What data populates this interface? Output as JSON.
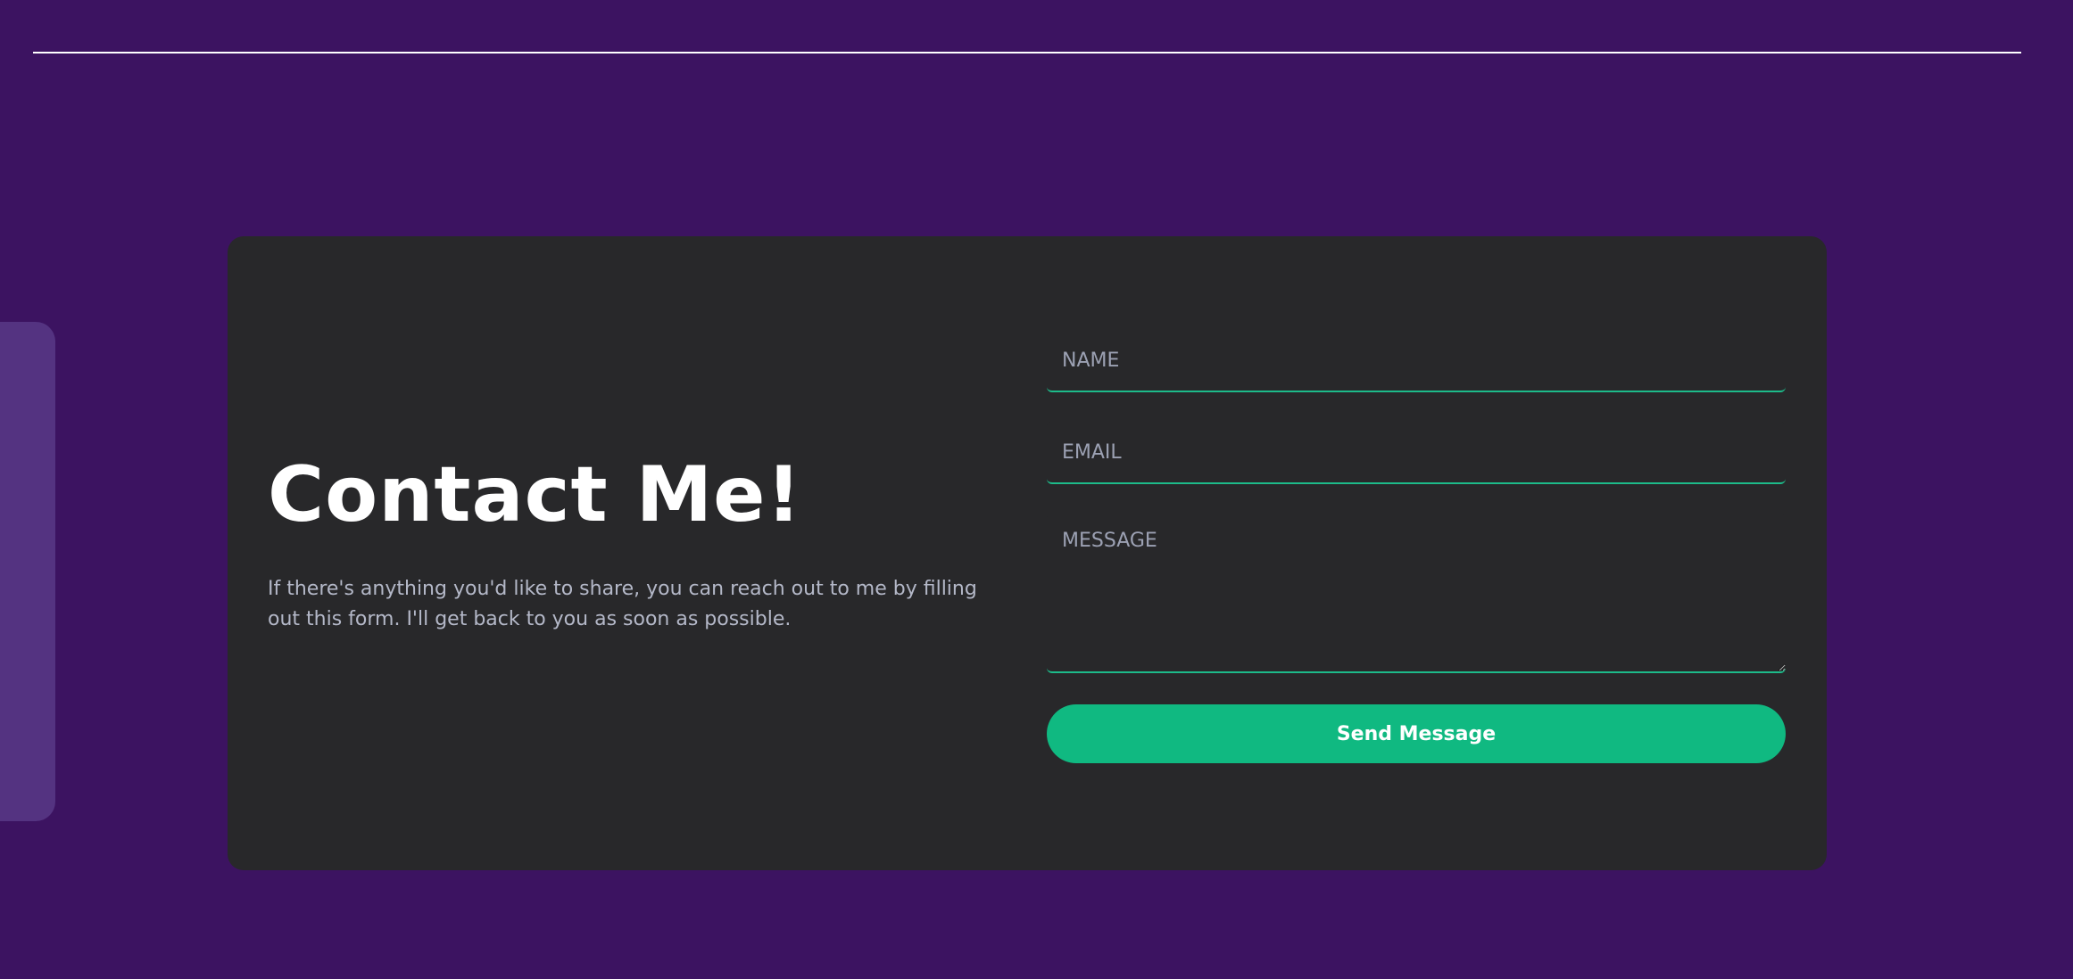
{
  "contact": {
    "title": "Contact Me!",
    "description": "If there's anything you'd like to share, you can reach out to me by filling out this form. I'll get back to you as soon as possible."
  },
  "form": {
    "name_placeholder": "NAME",
    "email_placeholder": "EMAIL",
    "message_placeholder": "MESSAGE",
    "submit_label": "Send Message"
  },
  "colors": {
    "background": "#3c1361",
    "card": "#28282a",
    "accent": "#10b981",
    "side_tab": "#543381"
  }
}
